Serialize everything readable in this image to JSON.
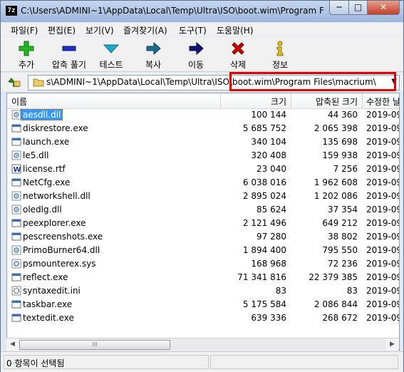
{
  "window": {
    "app_icon_text": "7z",
    "title": "C:\\Users\\ADMINI~1\\AppData\\Local\\Temp\\Ultra\\ISO\\boot.wim\\Program Files\\macrium\\",
    "min_label": "─",
    "max_label": "□",
    "close_label": "✕"
  },
  "menu": [
    "파일(F)",
    "편집(E)",
    "보기(V)",
    "즐겨찾기(A)",
    "도구(T)",
    "도움말(H)"
  ],
  "toolbar": [
    {
      "label": "추가",
      "icon": "plus-icon",
      "color": "#22b522"
    },
    {
      "label": "압축 풀기",
      "icon": "minus-icon",
      "color": "#1f2fbf"
    },
    {
      "label": "테스트",
      "icon": "checkmark-icon",
      "color": "#1fa7c7"
    },
    {
      "label": "복사",
      "icon": "copy-arrow-icon",
      "color": "#1e6b8f"
    },
    {
      "label": "이동",
      "icon": "move-arrow-icon",
      "color": "#11117a"
    },
    {
      "label": "삭제",
      "icon": "delete-x-icon",
      "color": "#d10000"
    },
    {
      "label": "정보",
      "icon": "info-icon",
      "color": "#e6c21c"
    }
  ],
  "address": {
    "path": "s\\ADMINI~1\\AppData\\Local\\Temp\\Ultra\\ISO\\boot.wim\\Program Files\\macrium\\",
    "dropdown": "▼"
  },
  "columns": {
    "name": "이름",
    "size": "크기",
    "packed": "압축된 크기",
    "modified": "수정한 날"
  },
  "files": [
    {
      "name": "aesdll.dll",
      "size": "100 144",
      "packed": "44 360",
      "modified": "2019-09",
      "icon": "dll-file-icon",
      "selected": true
    },
    {
      "name": "diskrestore.exe",
      "size": "5 685 752",
      "packed": "2 065 398",
      "modified": "2019-09",
      "icon": "exe-file-icon"
    },
    {
      "name": "launch.exe",
      "size": "340 104",
      "packed": "135 698",
      "modified": "2019-09",
      "icon": "exe-file-icon"
    },
    {
      "name": "le5.dll",
      "size": "320 408",
      "packed": "159 938",
      "modified": "2019-09",
      "icon": "dll-file-icon"
    },
    {
      "name": "license.rtf",
      "size": "23 040",
      "packed": "7 256",
      "modified": "2019-09",
      "icon": "rtf-file-icon"
    },
    {
      "name": "NetCfg.exe",
      "size": "6 038 016",
      "packed": "1 962 608",
      "modified": "2019-09",
      "icon": "exe-file-icon"
    },
    {
      "name": "networkshell.dll",
      "size": "2 895 024",
      "packed": "1 202 086",
      "modified": "2019-09",
      "icon": "dll-file-icon"
    },
    {
      "name": "oledlg.dll",
      "size": "85 624",
      "packed": "37 354",
      "modified": "2019-09",
      "icon": "dll-file-icon"
    },
    {
      "name": "peexplorer.exe",
      "size": "2 121 496",
      "packed": "649 212",
      "modified": "2019-09",
      "icon": "exe-file-icon"
    },
    {
      "name": "pescreenshots.exe",
      "size": "97 280",
      "packed": "38 802",
      "modified": "2019-09",
      "icon": "exe-file-icon"
    },
    {
      "name": "PrimoBurner64.dll",
      "size": "1 894 400",
      "packed": "795 550",
      "modified": "2019-09",
      "icon": "dll-file-icon"
    },
    {
      "name": "psmounterex.sys",
      "size": "168 968",
      "packed": "72 236",
      "modified": "2019-09",
      "icon": "sys-file-icon"
    },
    {
      "name": "reflect.exe",
      "size": "71 341 816",
      "packed": "22 379 385",
      "modified": "2019-09",
      "icon": "exe-file-icon"
    },
    {
      "name": "syntaxedit.ini",
      "size": "83",
      "packed": "83",
      "modified": "2019-09",
      "icon": "ini-file-icon"
    },
    {
      "name": "taskbar.exe",
      "size": "5 175 584",
      "packed": "2 086 844",
      "modified": "2019-09",
      "icon": "exe-file-icon"
    },
    {
      "name": "textedit.exe",
      "size": "639 336",
      "packed": "268 672",
      "modified": "2019-09",
      "icon": "exe-file-icon"
    }
  ],
  "scrollbar": {
    "left": "◀",
    "right": "▶",
    "grip": "III"
  },
  "status": {
    "text": "0 항목이 선택됨"
  }
}
